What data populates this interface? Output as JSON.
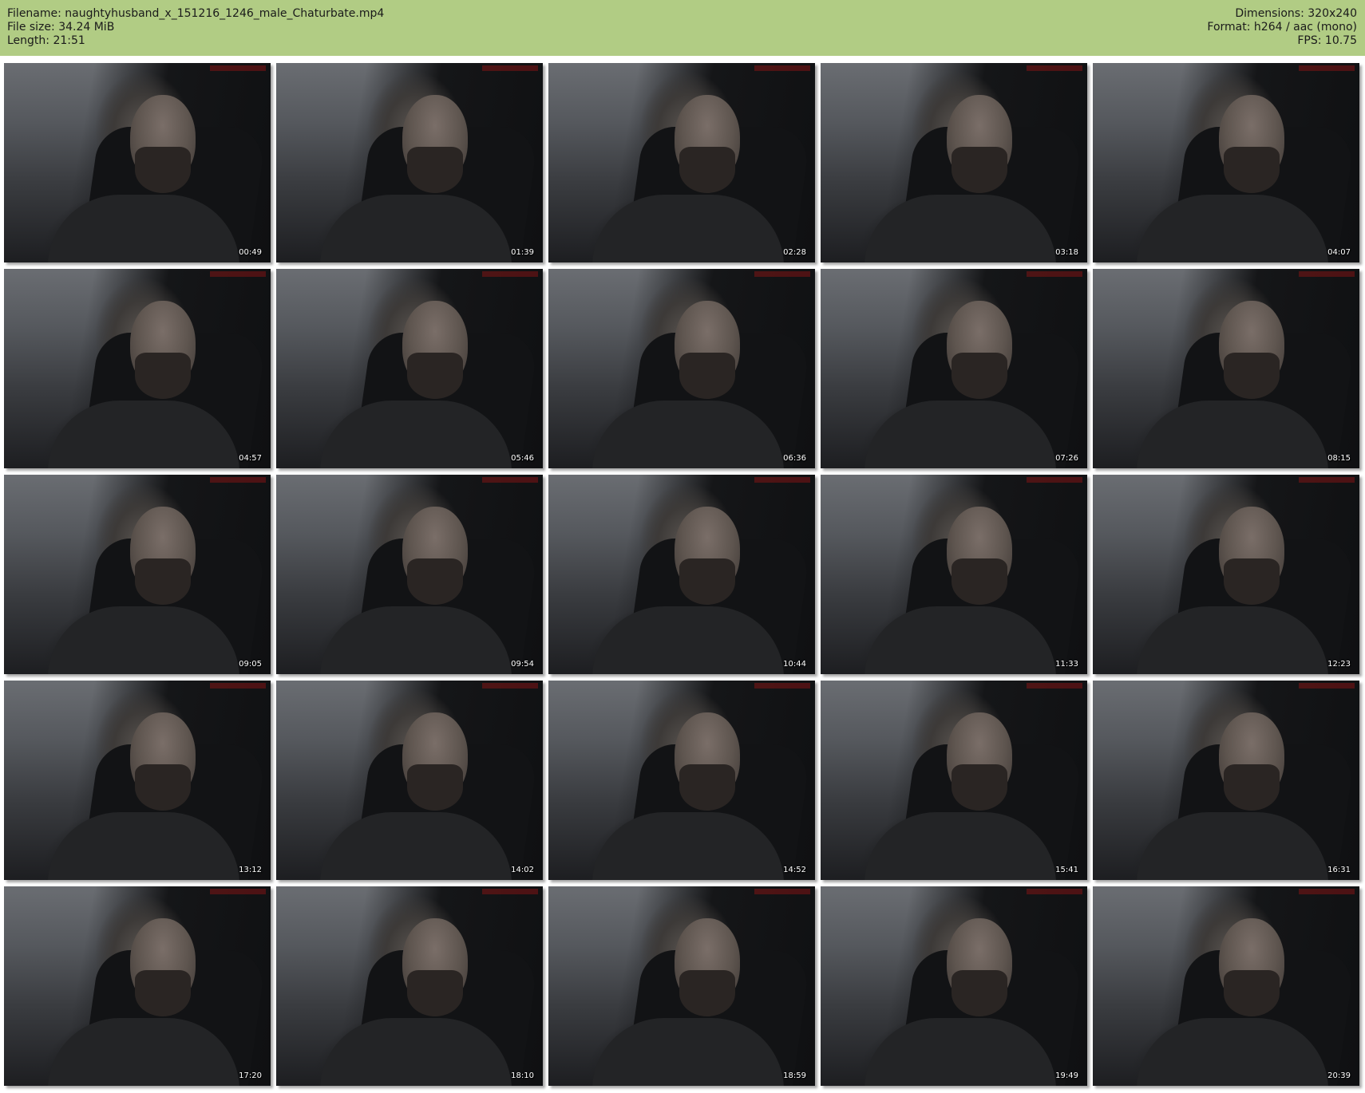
{
  "header": {
    "filename": "Filename: naughtyhusband_x_151216_1246_male_Chaturbate.mp4",
    "file_size": "File size: 34.24 MiB",
    "length": "Length: 21:51",
    "dimensions": "Dimensions: 320x240",
    "format": "Format: h264 / aac (mono)",
    "fps": "FPS: 10.75"
  },
  "colors": {
    "header_bg": "#b1cc84",
    "page_bg": "#ffffff"
  },
  "thumbnails": [
    {
      "timestamp": "00:49"
    },
    {
      "timestamp": "01:39"
    },
    {
      "timestamp": "02:28"
    },
    {
      "timestamp": "03:18"
    },
    {
      "timestamp": "04:07"
    },
    {
      "timestamp": "04:57"
    },
    {
      "timestamp": "05:46"
    },
    {
      "timestamp": "06:36"
    },
    {
      "timestamp": "07:26"
    },
    {
      "timestamp": "08:15"
    },
    {
      "timestamp": "09:05"
    },
    {
      "timestamp": "09:54"
    },
    {
      "timestamp": "10:44"
    },
    {
      "timestamp": "11:33"
    },
    {
      "timestamp": "12:23"
    },
    {
      "timestamp": "13:12"
    },
    {
      "timestamp": "14:02"
    },
    {
      "timestamp": "14:52"
    },
    {
      "timestamp": "15:41"
    },
    {
      "timestamp": "16:31"
    },
    {
      "timestamp": "17:20"
    },
    {
      "timestamp": "18:10"
    },
    {
      "timestamp": "18:59"
    },
    {
      "timestamp": "19:49"
    },
    {
      "timestamp": "20:39"
    }
  ]
}
